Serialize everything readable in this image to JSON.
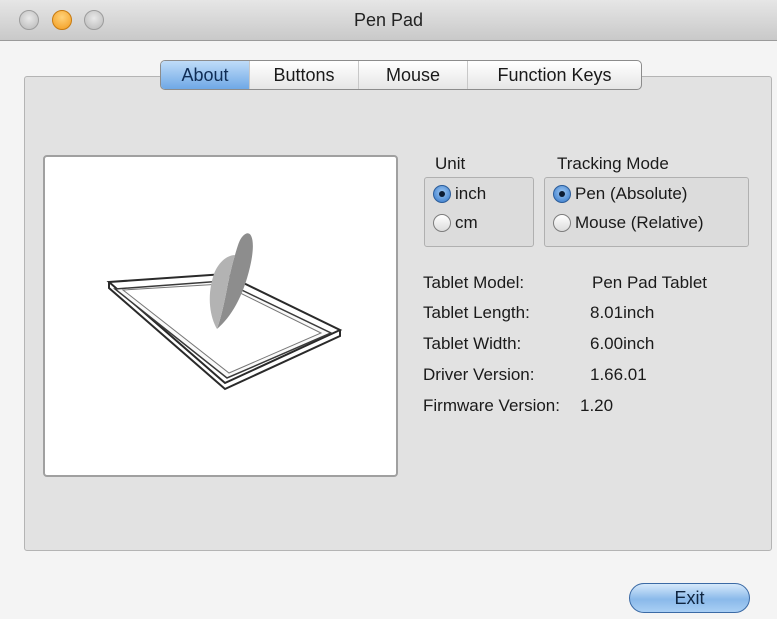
{
  "window": {
    "title": "Pen Pad"
  },
  "tabs": [
    {
      "label": "About",
      "active": true
    },
    {
      "label": "Buttons",
      "active": false
    },
    {
      "label": "Mouse",
      "active": false
    },
    {
      "label": "Function Keys",
      "active": false
    }
  ],
  "unit": {
    "label": "Unit",
    "options": [
      {
        "label": "inch",
        "selected": true
      },
      {
        "label": "cm",
        "selected": false
      }
    ]
  },
  "tracking_mode": {
    "label": "Tracking Mode",
    "options": [
      {
        "label": "Pen (Absolute)",
        "selected": true
      },
      {
        "label": "Mouse (Relative)",
        "selected": false
      }
    ]
  },
  "info": [
    {
      "label": "Tablet Model:",
      "value": "Pen Pad Tablet"
    },
    {
      "label": "Tablet Length:",
      "value": "8.01inch"
    },
    {
      "label": "Tablet Width:",
      "value": "6.00inch"
    },
    {
      "label": "Driver Version:",
      "value": "1.66.01"
    },
    {
      "label": "Firmware Version:",
      "value": "1.20"
    }
  ],
  "exit_label": "Exit",
  "colors": {
    "accent": "#5d9be0",
    "window_bg": "#e2e2e2"
  }
}
